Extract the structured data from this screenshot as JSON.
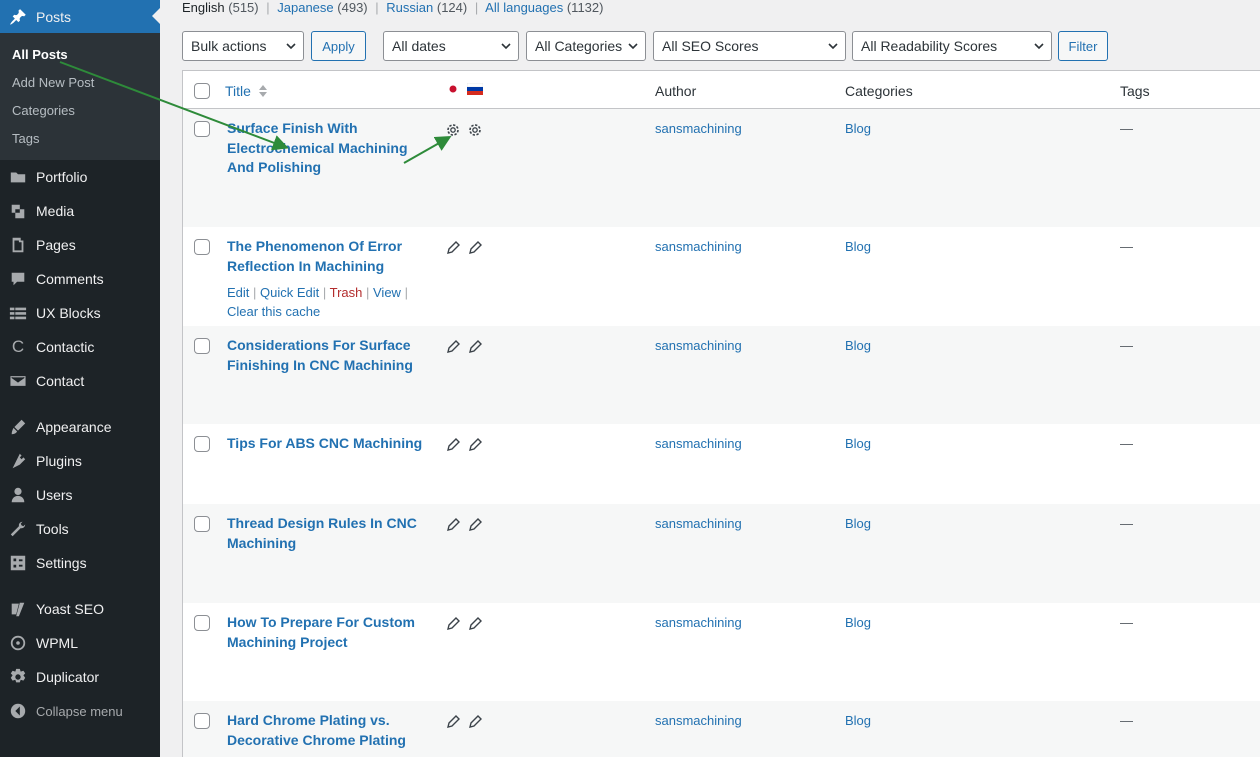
{
  "sidebar": {
    "posts_label": "Posts",
    "sub": [
      "All Posts",
      "Add New Post",
      "Categories",
      "Tags"
    ],
    "items": [
      {
        "label": "Portfolio",
        "icon": "portfolio-icon"
      },
      {
        "label": "Media",
        "icon": "media-icon"
      },
      {
        "label": "Pages",
        "icon": "pages-icon"
      },
      {
        "label": "Comments",
        "icon": "comments-icon"
      },
      {
        "label": "UX Blocks",
        "icon": "ux-blocks-icon"
      },
      {
        "label": "Contactic",
        "icon": "contactic-icon"
      },
      {
        "label": "Contact",
        "icon": "contact-icon"
      },
      {
        "label": "Appearance",
        "icon": "appearance-icon"
      },
      {
        "label": "Plugins",
        "icon": "plugins-icon"
      },
      {
        "label": "Users",
        "icon": "users-icon"
      },
      {
        "label": "Tools",
        "icon": "tools-icon"
      },
      {
        "label": "Settings",
        "icon": "settings-icon"
      },
      {
        "label": "Yoast SEO",
        "icon": "yoast-icon"
      },
      {
        "label": "WPML",
        "icon": "wpml-icon"
      },
      {
        "label": "Duplicator",
        "icon": "duplicator-icon"
      }
    ],
    "collapse": "Collapse menu"
  },
  "languages": [
    {
      "name": "English",
      "count": "(515)"
    },
    {
      "name": "Japanese",
      "count": "(493)"
    },
    {
      "name": "Russian",
      "count": "(124)"
    },
    {
      "name": "All languages",
      "count": "(1132)"
    }
  ],
  "filters": {
    "bulk": "Bulk actions",
    "apply": "Apply",
    "dates": "All dates",
    "categories": "All Categories",
    "seo": "All SEO Scores",
    "readability": "All Readability Scores",
    "filter": "Filter"
  },
  "columns": {
    "title": "Title",
    "author": "Author",
    "categories": "Categories",
    "tags": "Tags"
  },
  "posts": [
    {
      "title": "Surface Finish With Electrochemical Machining And Polishing",
      "author": "sansmachining",
      "category": "Blog",
      "tags": "—"
    },
    {
      "title": "The Phenomenon Of Error Reflection In Machining",
      "author": "sansmachining",
      "category": "Blog",
      "tags": "—"
    },
    {
      "title": "Considerations For Surface Finishing In CNC Machining",
      "author": "sansmachining",
      "category": "Blog",
      "tags": "—"
    },
    {
      "title": "Tips For ABS CNC Machining",
      "author": "sansmachining",
      "category": "Blog",
      "tags": "—"
    },
    {
      "title": "Thread Design Rules In CNC Machining",
      "author": "sansmachining",
      "category": "Blog",
      "tags": "—"
    },
    {
      "title": "How To Prepare For Custom Machining Project",
      "author": "sansmachining",
      "category": "Blog",
      "tags": "—"
    },
    {
      "title": "Hard Chrome Plating vs. Decorative Chrome Plating",
      "author": "sansmachining",
      "category": "Blog",
      "tags": "—"
    }
  ],
  "row_actions": {
    "edit": "Edit",
    "quick_edit": "Quick Edit",
    "trash": "Trash",
    "view": "View",
    "clear_cache": "Clear this cache"
  },
  "colors": {
    "link": "#2271b1",
    "sidebar_bg": "#1d2327",
    "active": "#2271b1",
    "arrow": "#2e8b3a",
    "trash": "#b32d2e"
  }
}
